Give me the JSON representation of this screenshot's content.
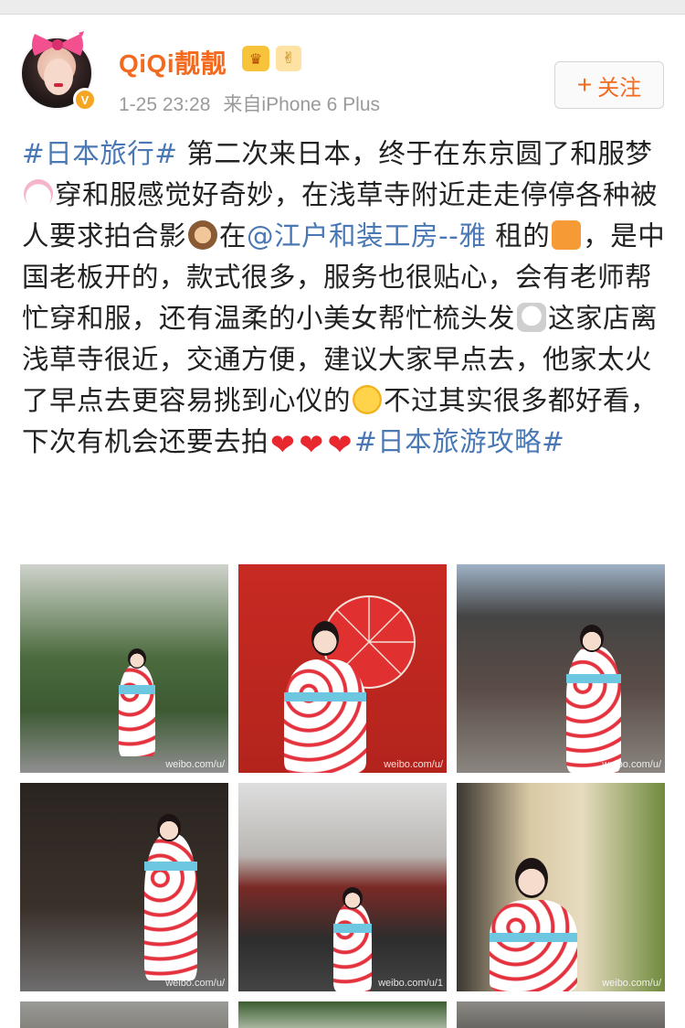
{
  "user": {
    "name": "QiQi靓靓",
    "avatar_badge": "V",
    "crown_icon": "crown-icon",
    "hand_icon": "victory-hand-icon"
  },
  "post": {
    "time": "1-25 23:28",
    "source": "来自iPhone 6 Plus",
    "segments": {
      "s1": "#日本旅行#",
      "s2": " 第二次来日本，终于在东京圆了和服梦",
      "s3": "穿和服感觉好奇妙，在浅草寺附近走走停停各种被人要求拍合影",
      "s4": "在",
      "s5": "@江户和装工房--雅",
      "s6": " 租的",
      "s7": "，是中国老板开的，款式很多，服务也很贴心，会有老师帮忙穿和服，还有温柔的小美女帮忙梳头发",
      "s8": "这家店离浅草寺很近，交通方便，建议大家早点去，他家太火了早点去更容易挑到心仪的",
      "s9": "不过其实很多都好看，下次有机会还要去拍",
      "s10": "#日本旅游攻略#"
    }
  },
  "follow_button": {
    "plus": "+",
    "label": "关注"
  },
  "photos": {
    "wm1": "weibo.com/u/",
    "wm2": "weibo.com/u/",
    "wm3": "weibo.com/u/",
    "wm4": "weibo.com/u/",
    "wm5": "weibo.com/u/1",
    "wm6": "weibo.com/u/"
  },
  "colors": {
    "username": "#f36a1f",
    "link": "#4a78b4",
    "meta": "#9a9a9a",
    "heart": "#e8272e"
  }
}
